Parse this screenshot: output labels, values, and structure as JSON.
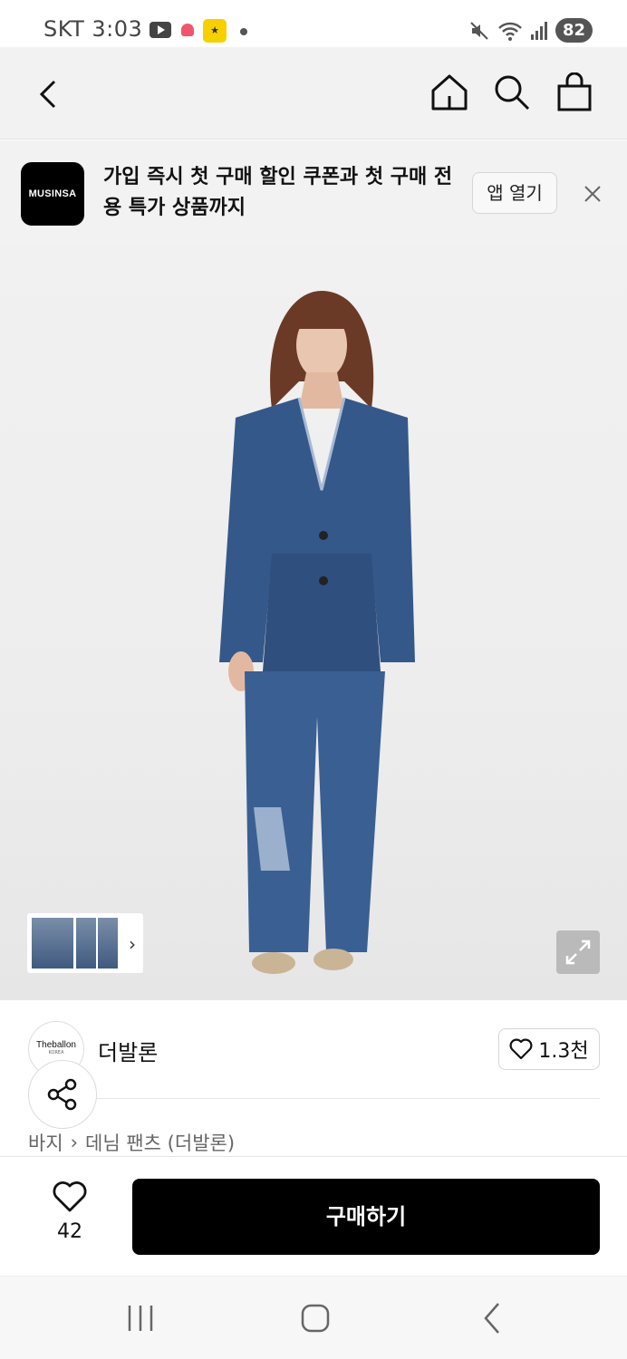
{
  "status_bar": {
    "carrier_time": "SKT 3:03",
    "battery": "82"
  },
  "banner": {
    "logo_text": "MUSINSA",
    "message": "가입 즉시 첫 구매 할인 쿠폰과 첫 구매 전용 특가 상품까지",
    "open_label": "앱 열기"
  },
  "brand": {
    "logo_text": "Theballon",
    "logo_sub": "KOREA",
    "name": "더발론",
    "likes": "1.3천"
  },
  "breadcrumb": {
    "items": [
      "바지",
      "데님 팬츠 (더발론)"
    ]
  },
  "purchase": {
    "wish_count": "42",
    "buy_label": "구매하기"
  },
  "colors": {
    "buy_button": "#000000",
    "nav_bg": "#f2f2f2",
    "denim": "#35588a"
  }
}
